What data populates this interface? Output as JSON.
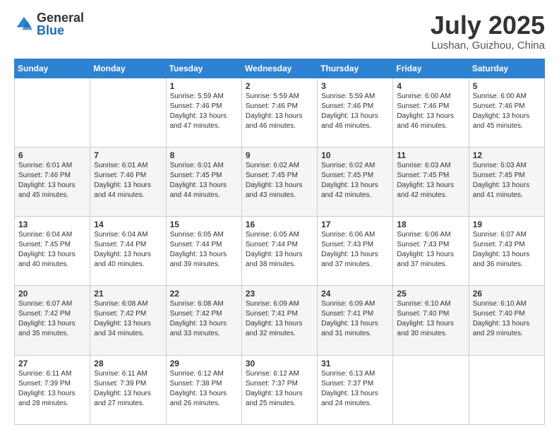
{
  "header": {
    "logo_general": "General",
    "logo_blue": "Blue",
    "month_title": "July 2025",
    "location": "Lushan, Guizhou, China"
  },
  "weekdays": [
    "Sunday",
    "Monday",
    "Tuesday",
    "Wednesday",
    "Thursday",
    "Friday",
    "Saturday"
  ],
  "weeks": [
    [
      {
        "day": "",
        "info": ""
      },
      {
        "day": "",
        "info": ""
      },
      {
        "day": "1",
        "info": "Sunrise: 5:59 AM\nSunset: 7:46 PM\nDaylight: 13 hours and 47 minutes."
      },
      {
        "day": "2",
        "info": "Sunrise: 5:59 AM\nSunset: 7:46 PM\nDaylight: 13 hours and 46 minutes."
      },
      {
        "day": "3",
        "info": "Sunrise: 5:59 AM\nSunset: 7:46 PM\nDaylight: 13 hours and 46 minutes."
      },
      {
        "day": "4",
        "info": "Sunrise: 6:00 AM\nSunset: 7:46 PM\nDaylight: 13 hours and 46 minutes."
      },
      {
        "day": "5",
        "info": "Sunrise: 6:00 AM\nSunset: 7:46 PM\nDaylight: 13 hours and 45 minutes."
      }
    ],
    [
      {
        "day": "6",
        "info": "Sunrise: 6:01 AM\nSunset: 7:46 PM\nDaylight: 13 hours and 45 minutes."
      },
      {
        "day": "7",
        "info": "Sunrise: 6:01 AM\nSunset: 7:46 PM\nDaylight: 13 hours and 44 minutes."
      },
      {
        "day": "8",
        "info": "Sunrise: 6:01 AM\nSunset: 7:45 PM\nDaylight: 13 hours and 44 minutes."
      },
      {
        "day": "9",
        "info": "Sunrise: 6:02 AM\nSunset: 7:45 PM\nDaylight: 13 hours and 43 minutes."
      },
      {
        "day": "10",
        "info": "Sunrise: 6:02 AM\nSunset: 7:45 PM\nDaylight: 13 hours and 42 minutes."
      },
      {
        "day": "11",
        "info": "Sunrise: 6:03 AM\nSunset: 7:45 PM\nDaylight: 13 hours and 42 minutes."
      },
      {
        "day": "12",
        "info": "Sunrise: 6:03 AM\nSunset: 7:45 PM\nDaylight: 13 hours and 41 minutes."
      }
    ],
    [
      {
        "day": "13",
        "info": "Sunrise: 6:04 AM\nSunset: 7:45 PM\nDaylight: 13 hours and 40 minutes."
      },
      {
        "day": "14",
        "info": "Sunrise: 6:04 AM\nSunset: 7:44 PM\nDaylight: 13 hours and 40 minutes."
      },
      {
        "day": "15",
        "info": "Sunrise: 6:05 AM\nSunset: 7:44 PM\nDaylight: 13 hours and 39 minutes."
      },
      {
        "day": "16",
        "info": "Sunrise: 6:05 AM\nSunset: 7:44 PM\nDaylight: 13 hours and 38 minutes."
      },
      {
        "day": "17",
        "info": "Sunrise: 6:06 AM\nSunset: 7:43 PM\nDaylight: 13 hours and 37 minutes."
      },
      {
        "day": "18",
        "info": "Sunrise: 6:06 AM\nSunset: 7:43 PM\nDaylight: 13 hours and 37 minutes."
      },
      {
        "day": "19",
        "info": "Sunrise: 6:07 AM\nSunset: 7:43 PM\nDaylight: 13 hours and 36 minutes."
      }
    ],
    [
      {
        "day": "20",
        "info": "Sunrise: 6:07 AM\nSunset: 7:42 PM\nDaylight: 13 hours and 35 minutes."
      },
      {
        "day": "21",
        "info": "Sunrise: 6:08 AM\nSunset: 7:42 PM\nDaylight: 13 hours and 34 minutes."
      },
      {
        "day": "22",
        "info": "Sunrise: 6:08 AM\nSunset: 7:42 PM\nDaylight: 13 hours and 33 minutes."
      },
      {
        "day": "23",
        "info": "Sunrise: 6:09 AM\nSunset: 7:41 PM\nDaylight: 13 hours and 32 minutes."
      },
      {
        "day": "24",
        "info": "Sunrise: 6:09 AM\nSunset: 7:41 PM\nDaylight: 13 hours and 31 minutes."
      },
      {
        "day": "25",
        "info": "Sunrise: 6:10 AM\nSunset: 7:40 PM\nDaylight: 13 hours and 30 minutes."
      },
      {
        "day": "26",
        "info": "Sunrise: 6:10 AM\nSunset: 7:40 PM\nDaylight: 13 hours and 29 minutes."
      }
    ],
    [
      {
        "day": "27",
        "info": "Sunrise: 6:11 AM\nSunset: 7:39 PM\nDaylight: 13 hours and 28 minutes."
      },
      {
        "day": "28",
        "info": "Sunrise: 6:11 AM\nSunset: 7:39 PM\nDaylight: 13 hours and 27 minutes."
      },
      {
        "day": "29",
        "info": "Sunrise: 6:12 AM\nSunset: 7:38 PM\nDaylight: 13 hours and 26 minutes."
      },
      {
        "day": "30",
        "info": "Sunrise: 6:12 AM\nSunset: 7:37 PM\nDaylight: 13 hours and 25 minutes."
      },
      {
        "day": "31",
        "info": "Sunrise: 6:13 AM\nSunset: 7:37 PM\nDaylight: 13 hours and 24 minutes."
      },
      {
        "day": "",
        "info": ""
      },
      {
        "day": "",
        "info": ""
      }
    ]
  ]
}
